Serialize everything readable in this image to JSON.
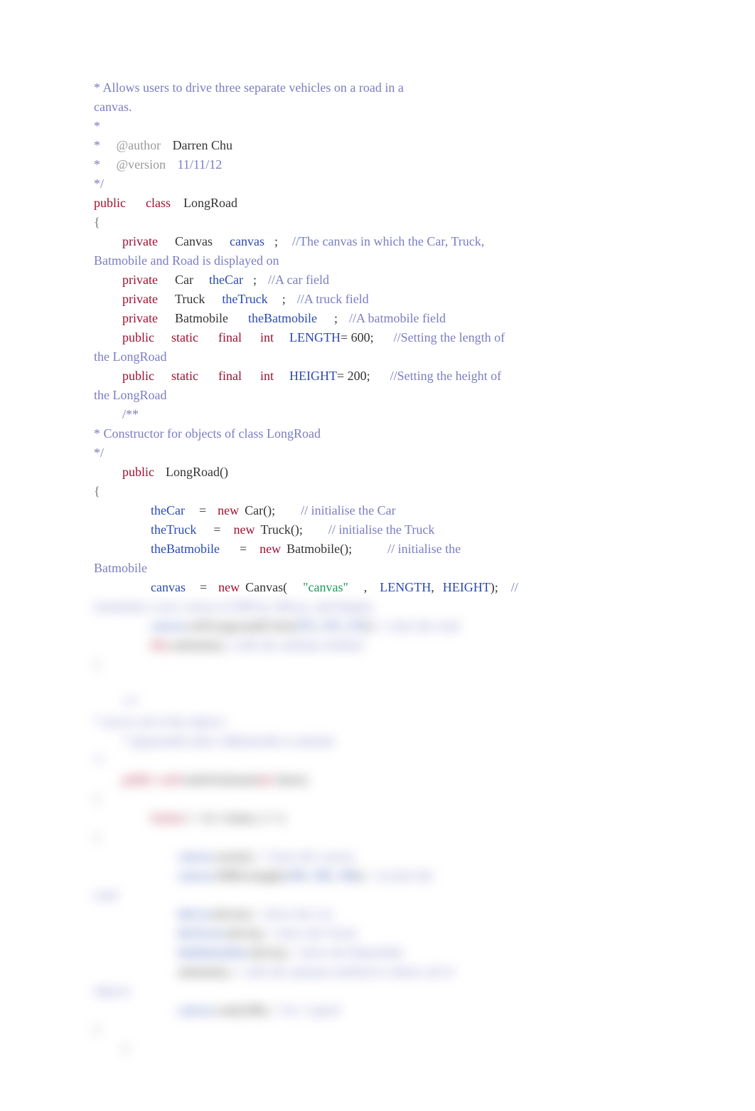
{
  "header": {
    "line1": "* Allows users to drive three separate vehicles on a road in a",
    "line2": "canvas.",
    "line3": "*",
    "author_star": " * ",
    "author_tag": "@author ",
    "author_name": "Darren Chu",
    "version_star": " * ",
    "version_tag": "@version ",
    "version_val": "11/11/12",
    "close": "*/"
  },
  "classDecl": {
    "kw_public": "public",
    "kw_class": "class",
    "name": "LongRoad"
  },
  "fields": {
    "canvas": {
      "kw": "private",
      "type": "Canvas",
      "name": "canvas",
      "semi": ";",
      "comment": "//The canvas in which the Car, Truck,"
    },
    "canvas_cont": "Batmobile and Road is displayed on",
    "car": {
      "kw": "private",
      "type": "Car",
      "name": "theCar",
      "semi": ";",
      "comment": "//A car field"
    },
    "truck": {
      "kw": "private",
      "type": "Truck",
      "name": "theTruck",
      "semi": ";",
      "comment": "//A truck field"
    },
    "batmobile": {
      "kw": "private",
      "type": "Batmobile",
      "name": "theBatmobile",
      "semi": ";",
      "comment": "//A batmobile field"
    },
    "length": {
      "kw_public": "public",
      "kw_static": "static",
      "kw_final": "final",
      "kw_int": "int",
      "name": "LENGTH",
      "val": "= 600;",
      "comment": "//Setting the length of"
    },
    "length_cont": "the LongRoad",
    "height": {
      "kw_public": "public",
      "kw_static": "static",
      "kw_final": "final",
      "kw_int": "int",
      "name": "HEIGHT",
      "val": "= 200;",
      "comment": "//Setting the height of"
    },
    "height_cont": "the LongRoad"
  },
  "ctorDoc": {
    "open": "/**",
    "line": "* Constructor for objects of class LongRoad",
    "close": "*/"
  },
  "ctor": {
    "kw": "public",
    "name": "LongRoad()"
  },
  "body": {
    "car": {
      "lhs": "theCar",
      "eq": "=",
      "new": "new",
      "rhs": "Car();",
      "comment": "// initialise the Car"
    },
    "truck": {
      "lhs": "theTruck",
      "eq": "=",
      "new": "new",
      "rhs": "Truck();",
      "comment": "// initialise the Truck"
    },
    "bat": {
      "lhs": "theBatmobile",
      "eq": "=",
      "new": "new",
      "rhs": "Batmobile();",
      "comment": "// initialise the"
    },
    "bat_cont": "Batmobile",
    "canvas": {
      "lhs": "canvas",
      "eq": "=",
      "new": "new",
      "type": "Canvas(",
      "str": "\"canvas\"",
      "comma": ",",
      "arg1": "LENGTH",
      "comma2": ",",
      "arg2": "HEIGHT",
      "close": ");",
      "comment": "//"
    }
  },
  "blurred": {
    "l1": "instantiate a new canvas of 600 by 200 px, and display",
    "l2a": "canvas",
    "l2b": ".setForegroundColor(",
    "l2c": "255",
    "l2d": ",",
    "l2e": "255",
    "l2f": ",",
    "l2g": "255",
    "l2h": ");",
    "l2i": "// color the road",
    "l3a": "this",
    "l3b": ".animate();",
    "l3c": "//calls the animate method",
    "l4": "}",
    "doc1": "/**",
    "doc2": "* moves all of the objects",
    "doc3": "*     @param& times     of&times& to animate",
    "doc4": "*/",
    "m1a": "public void",
    "m1b": " multiAnimate(",
    "m1c": "int",
    "m1d": " times)",
    "m2": "{",
    "m3a": "for(",
    "m3b": "int",
    "m3c": " i = 0; i<times; i++)",
    "m4": "{",
    "m5a": "canvas",
    "m5b": ".erase();",
    "m5c": "// clears the canvas",
    "m6a": "canvas",
    "m6b": ".fillRectangle(",
    "m6c": "100",
    "m6d": ", ",
    "m6e": "100",
    "m6f": ", ",
    "m6g": "100",
    "m6h": ");",
    "m6i": "// recolor the",
    "m6j": "road",
    "m7a": "theCar",
    "m7b": ".drive();",
    "m7c": "// drive the Car",
    "m8a": "theTruck",
    "m8b": ".drive();",
    "m8c": "// drive the Truck",
    "m9a": "theBatmobile",
    "m9b": ".drive();",
    "m9c": "// drive the Batmobile",
    "m10a": "animate();",
    "m10b": "// calls the animate method to redraw all of",
    "m10c": "objects",
    "m11a": "canvas",
    "m11b": ".wait(100);",
    "m11c": "// for 1 speed",
    "m12": "}",
    "m13": "}"
  }
}
